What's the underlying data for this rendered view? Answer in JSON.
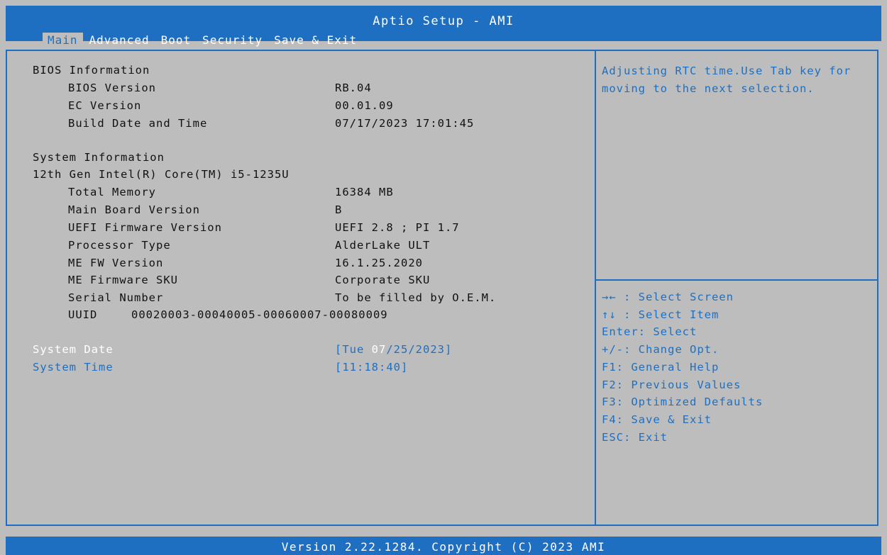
{
  "header": {
    "title": "Aptio Setup - AMI",
    "tabs": [
      {
        "label": "Main",
        "active": true
      },
      {
        "label": "Advanced",
        "active": false
      },
      {
        "label": "Boot",
        "active": false
      },
      {
        "label": "Security",
        "active": false
      },
      {
        "label": "Save & Exit",
        "active": false
      }
    ]
  },
  "main": {
    "bios_info": {
      "heading": "BIOS Information",
      "bios_version": {
        "label": "BIOS Version",
        "value": "RB.04"
      },
      "ec_version": {
        "label": "EC Version",
        "value": "00.01.09"
      },
      "build_date": {
        "label": "Build Date and Time",
        "value": "07/17/2023 17:01:45"
      }
    },
    "system_info": {
      "heading": "System Information",
      "cpu": "12th Gen Intel(R) Core(TM) i5-1235U",
      "total_memory": {
        "label": "Total Memory",
        "value": "16384 MB"
      },
      "main_board": {
        "label": "Main Board Version",
        "value": "B"
      },
      "uefi_fw": {
        "label": "UEFI Firmware Version",
        "value": "UEFI 2.8 ; PI 1.7"
      },
      "processor_type": {
        "label": "Processor Type",
        "value": "AlderLake ULT"
      },
      "me_fw_version": {
        "label": "ME FW Version",
        "value": "16.1.25.2020"
      },
      "me_fw_sku": {
        "label": "ME Firmware SKU",
        "value": "Corporate SKU"
      },
      "serial": {
        "label": "Serial Number",
        "value": "To be filled by O.E.M."
      },
      "uuid": {
        "label": "UUID",
        "value": "00020003-00040005-00060007-00080009"
      }
    },
    "system_date": {
      "label": "System Date",
      "value_prefix": "[Tue ",
      "value_month": "07",
      "value_suffix": "/25/2023]"
    },
    "system_time": {
      "label": "System Time",
      "value": "[11:18:40]"
    }
  },
  "help": {
    "text": "Adjusting RTC time.Use Tab key for moving to the next selection."
  },
  "keys": [
    "→← : Select Screen",
    "↑↓ : Select Item",
    "Enter: Select",
    "+/-: Change Opt.",
    "F1: General Help",
    "F2: Previous Values",
    "F3: Optimized Defaults",
    "F4: Save & Exit",
    "ESC: Exit"
  ],
  "footer": {
    "text": "Version 2.22.1284. Copyright (C) 2023 AMI"
  },
  "colors": {
    "accent": "#1e6fc2",
    "background": "#bdbdbd",
    "text": "#111111",
    "selected": "#ffffff"
  }
}
